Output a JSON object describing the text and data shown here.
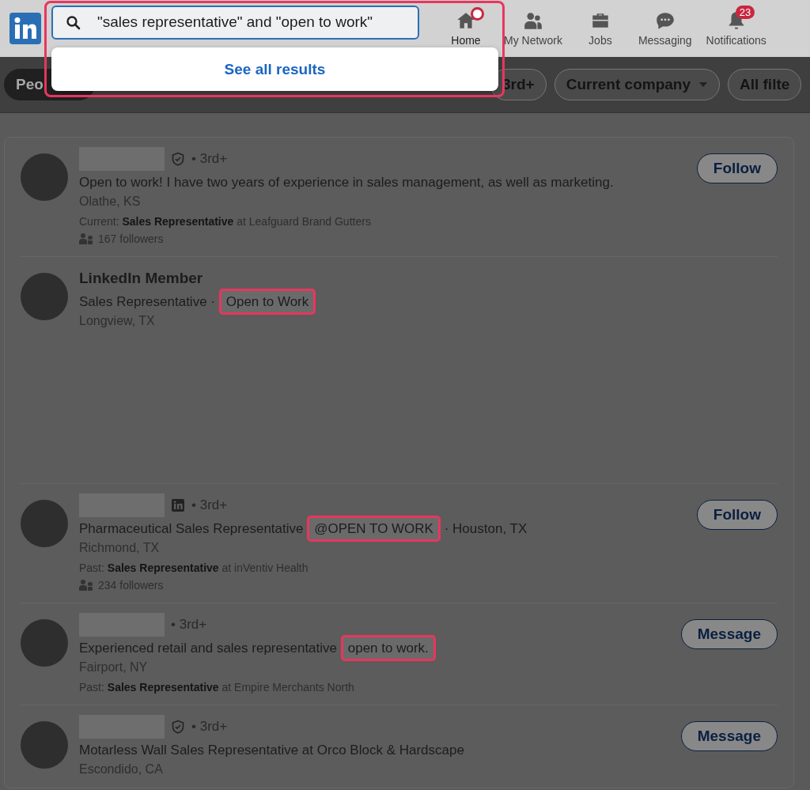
{
  "header": {
    "search": {
      "value": "\"sales representative\" and \"open to work\""
    },
    "suggestion": "See all results",
    "nav": [
      {
        "label": "Home",
        "kind": "home",
        "dot": true
      },
      {
        "label": "My Network",
        "kind": "people"
      },
      {
        "label": "Jobs",
        "kind": "briefcase"
      },
      {
        "label": "Messaging",
        "kind": "chat"
      },
      {
        "label": "Notifications",
        "kind": "bell",
        "badge": "23"
      }
    ]
  },
  "filters": [
    {
      "label": "Peo",
      "selected": true,
      "kind": "pill"
    },
    {
      "label": "3rd+",
      "selected": false,
      "kind": "pill"
    },
    {
      "label": "Current company",
      "selected": false,
      "kind": "dropdown"
    },
    {
      "label": "All filte",
      "selected": false,
      "kind": "pill"
    }
  ],
  "results": [
    {
      "redacted": true,
      "kind": "shield",
      "degree": "• 3rd+",
      "headline": [
        {
          "text": "Open to work! I have two years of experience in sales management, as well as marketing.",
          "highlighted": false
        }
      ],
      "location": "Olathe, KS",
      "summary": "Current: **Sales Representative** at Leafguard Brand Gutters",
      "followers": "167 followers",
      "action": "Follow",
      "tall": false
    },
    {
      "redacted": false,
      "kind": "plain",
      "name": "LinkedIn Member",
      "headline": [
        {
          "text": "Sales Representative · ",
          "highlighted": false
        },
        {
          "text": "Open to Work",
          "highlighted": true
        }
      ],
      "location": "Longview, TX",
      "tall": true
    },
    {
      "redacted": true,
      "kind": "linkedin",
      "degree": "• 3rd+",
      "headline": [
        {
          "text": "Pharmaceutical Sales Representative ",
          "highlighted": false
        },
        {
          "text": "@OPEN TO WORK",
          "highlighted": true
        },
        {
          "text": " · Houston, TX",
          "highlighted": false
        }
      ],
      "location": "Richmond, TX",
      "summary": "Past: **Sales Representative** at inVentiv Health",
      "followers": "234 followers",
      "action": "Follow",
      "tall": false
    },
    {
      "redacted": true,
      "kind": "plain",
      "degree": "• 3rd+",
      "headline": [
        {
          "text": "Experienced retail and sales representative ",
          "highlighted": false
        },
        {
          "text": "open to work.",
          "highlighted": true
        }
      ],
      "location": "Fairport, NY",
      "summary": "Past: **Sales Representative** at Empire Merchants North",
      "action": "Message",
      "tall": false
    },
    {
      "redacted": true,
      "kind": "shield",
      "degree": "• 3rd+",
      "headline": [
        {
          "text": "Motarless Wall Sales Representative at Orco Block & Hardscape",
          "highlighted": false
        }
      ],
      "location": "Escondido, CA",
      "action": "Message",
      "tall": false
    }
  ]
}
